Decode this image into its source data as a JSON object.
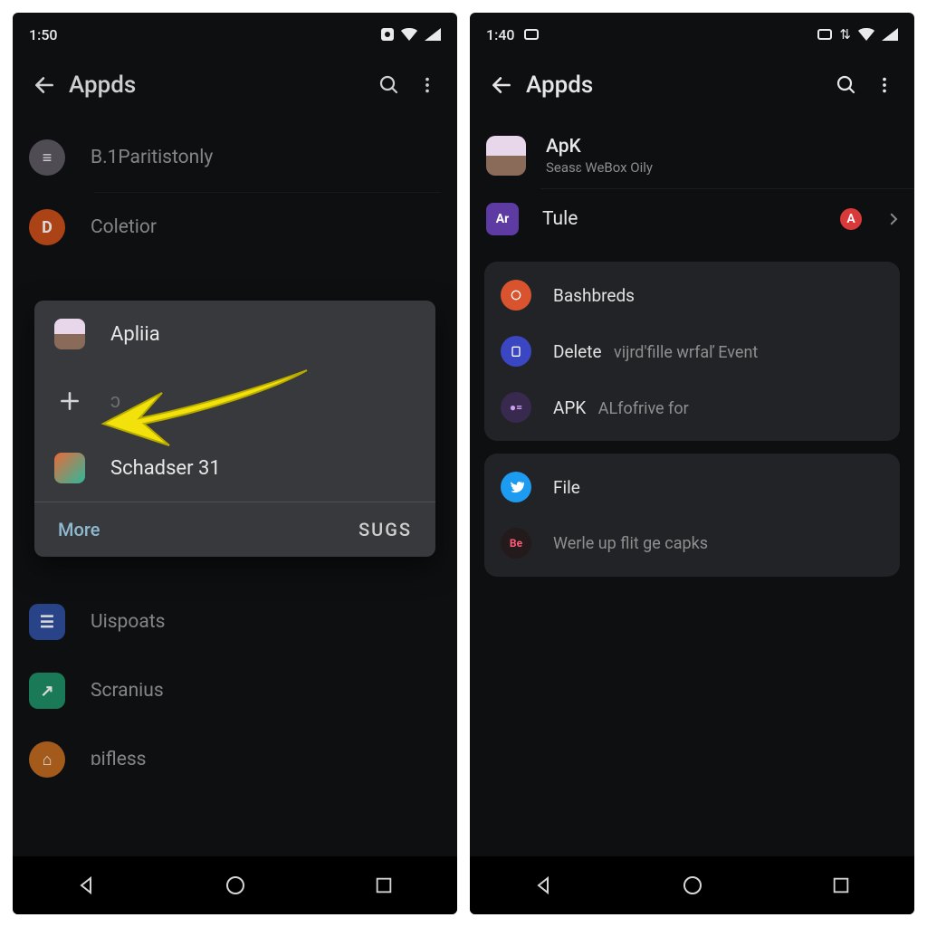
{
  "left": {
    "status": {
      "time": "1:50"
    },
    "appbar": {
      "title": "Appds"
    },
    "list": [
      {
        "icon_bg": "#5e5a62",
        "icon_text": "≡",
        "label": "B.1Paritistonly"
      },
      {
        "icon_bg": "#c94f1a",
        "icon_text": "D",
        "label": "Coletior"
      },
      {
        "icon_bg": "#2f4fa0",
        "icon_text": "☰",
        "label": "Uispoats"
      },
      {
        "icon_bg": "#1f8f68",
        "icon_text": "↗",
        "label": "Scranius"
      },
      {
        "icon_bg": "#c06a1e",
        "icon_text": "⌂",
        "label": "ɒifless"
      }
    ],
    "popup": {
      "item1": {
        "label": "Apliia"
      },
      "item3": {
        "label": "Schadser 31"
      },
      "more": "More",
      "sugs": "SUGS"
    }
  },
  "right": {
    "status": {
      "time": "1:40"
    },
    "appbar": {
      "title": "Appds"
    },
    "header": {
      "title": "ApK",
      "subtitle": "Seasɛ WeBox Oily"
    },
    "tule": {
      "label": "Tule",
      "badge": "A"
    },
    "group1": {
      "r1": "Bashbreds",
      "r2_a": "Delete",
      "r2_b": "vijrd'fille wrfaľ Event",
      "r3_a": "APK",
      "r3_b": "ALfofrive for"
    },
    "group2": {
      "r1": "File",
      "r2": "Werle up flit ge capks"
    }
  }
}
